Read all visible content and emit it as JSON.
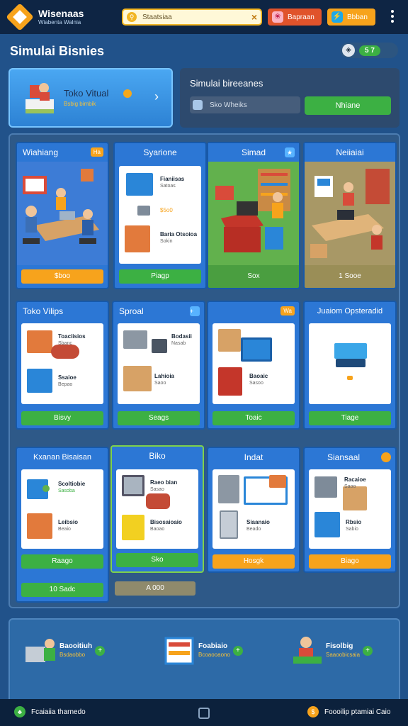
{
  "header": {
    "brand_title": "Wisenaas",
    "brand_subtitle": "Wiabenta Walnia",
    "search_placeholder": "Staatsiaa",
    "btn1_label": "Bapraan",
    "btn2_label": "Bbban"
  },
  "page": {
    "title": "Simulai Bisnies",
    "stat_value": "5 7"
  },
  "card_virtual": {
    "title": "Toko Vitual",
    "subtitle": "Bsbig bimbik"
  },
  "card_sim": {
    "title": "Simulai bireeanes",
    "input_placeholder": "Sko Wheiks",
    "button": "Nhiane"
  },
  "tiles": [
    {
      "title": "Wiahiang",
      "badge": "Ha",
      "button": "$boo"
    },
    {
      "title": "Syarione",
      "label1": "Fianiisas",
      "label1_sub": "Satoas",
      "label2": "Baria Otsoioa",
      "label2_sub": "Sokin",
      "price": "$5o0",
      "button": "Piagp"
    },
    {
      "title": "Simad",
      "button": "Sox"
    },
    {
      "title": "Neiiaiai",
      "button": "1 Sooe"
    },
    {
      "title": "Toko Vilips",
      "label1": "Toaciisios",
      "label1_sub": "Sbanc",
      "label2": "Ssaioe",
      "label2_sub": "Bepao",
      "button": "Bisvy"
    },
    {
      "title": "Sproal",
      "label1": "Bodasii",
      "label1_sub": "Nasab",
      "label2": "Lahioia",
      "label2_sub": "Saoo",
      "button": "Seags"
    },
    {
      "title": "",
      "badge": "Wa",
      "label1": "Baoaic",
      "label1_sub": "Sasoo",
      "button": "Toaic"
    },
    {
      "title": "Juaiom Opsteradid",
      "button": "Tiage"
    },
    {
      "title": "Kxanan Bisaisan",
      "label1": "Scoltiobie",
      "label1_sub": "Sasoba",
      "label2": "Leibsio",
      "label2_sub": "Beaio",
      "button": "Raago",
      "extra_button": "10 Sadc"
    },
    {
      "title": "Biko",
      "label1": "Raeo bian",
      "label1_sub": "Sasao",
      "label2": "Bisosaioaio",
      "label2_sub": "Baoao",
      "button": "Sko",
      "extra_button": "A 000"
    },
    {
      "title": "Indat",
      "label1": "Siaanaio",
      "label1_sub": "Beado",
      "button": "Hosgk"
    },
    {
      "title": "Siansaal",
      "label1": "Racaioe",
      "label1_sub": "Saoo",
      "label2": "Rbsio",
      "label2_sub": "Sabio",
      "button": "Biago"
    }
  ],
  "bottom_items": [
    {
      "title": "Baooitiuh",
      "sub": "Bsdaobbo"
    },
    {
      "title": "Foabiaio",
      "sub": "Bcoaooaono"
    },
    {
      "title": "Fisolbig",
      "sub": "Saaoobicsaia"
    }
  ],
  "nav": {
    "left": "Fcaiaiia tharnedo",
    "right": "Foooilip ptamiai Caio"
  },
  "colors": {
    "accent": "#f7a31c",
    "primary": "#2c77d5",
    "success": "#3cb043",
    "bg": "#21528a"
  }
}
